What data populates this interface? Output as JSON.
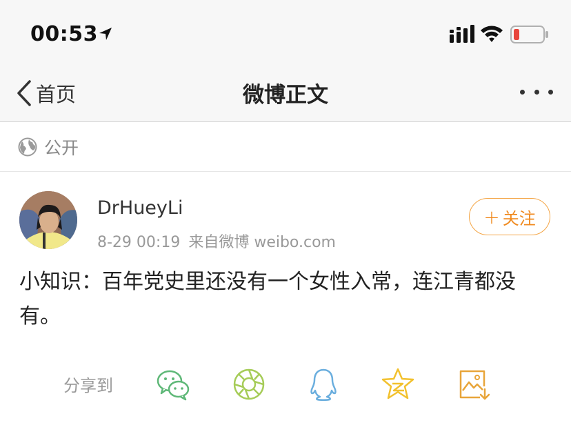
{
  "status_bar": {
    "time": "00:53"
  },
  "nav": {
    "back_label": "首页",
    "title": "微博正文"
  },
  "visibility": {
    "label": "公开"
  },
  "post": {
    "username": "DrHueyLi",
    "time": "8-29 00:19",
    "source": "来自微博 weibo.com",
    "follow_label": "关注",
    "text": "小知识：百年党史里还没有一个女性入常，连江青都没有。"
  },
  "share": {
    "label": "分享到",
    "targets": [
      "wechat-icon",
      "moments-icon",
      "qq-icon",
      "qzone-icon",
      "save-image-icon"
    ]
  },
  "colors": {
    "accent": "#f08a1f",
    "wechat": "#5fb878",
    "moments": "#a6cc58",
    "qq": "#6aaede",
    "qzone": "#f2c12e",
    "save": "#e8a53a",
    "battery_low": "#e8453c"
  }
}
